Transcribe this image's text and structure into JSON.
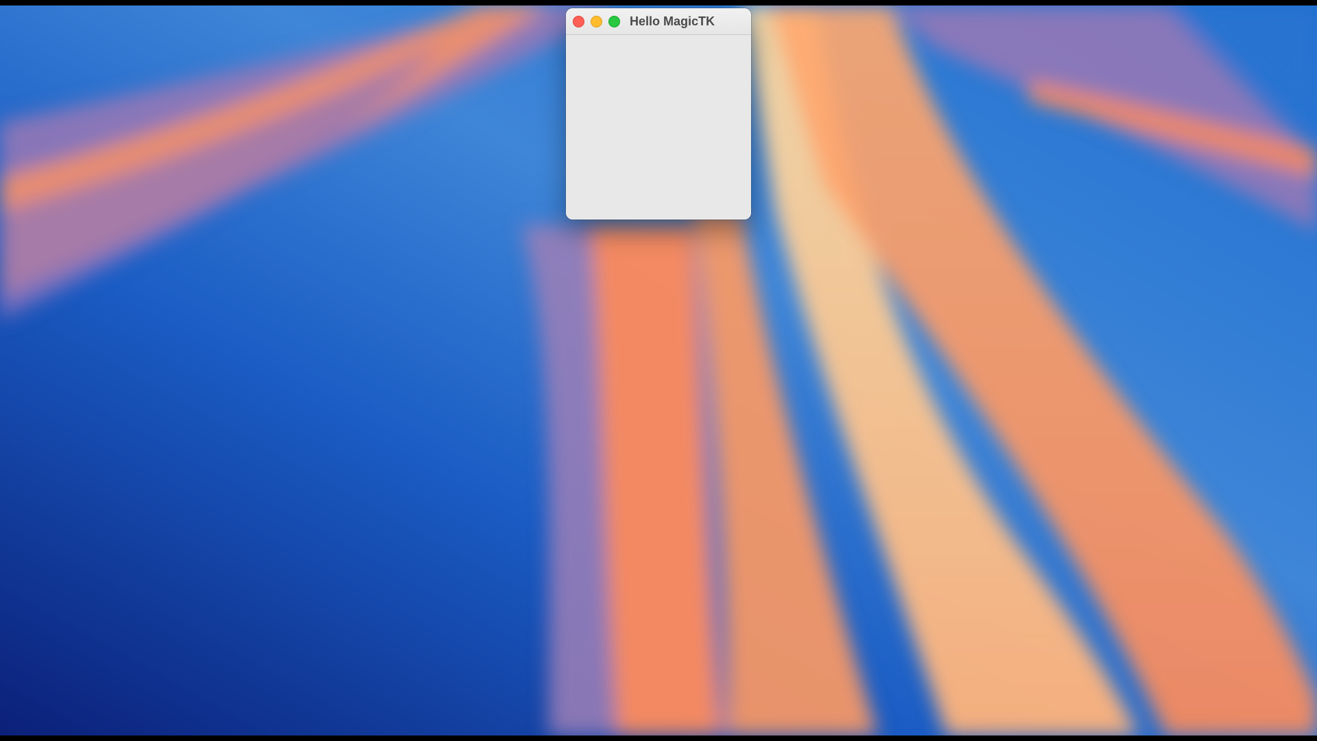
{
  "window": {
    "title": "Hello MagicTK",
    "controls": {
      "close": "close-icon",
      "minimize": "minimize-icon",
      "zoom": "zoom-icon"
    },
    "colors": {
      "close": "#ff5f57",
      "minimize": "#febc2e",
      "zoom": "#28c840",
      "content_background": "#e8e8e8"
    }
  },
  "desktop": {
    "wallpaper_colors": [
      "#0b2a86",
      "#1f6fd0",
      "#8e6fb3",
      "#ff8a55",
      "#f7d3a0"
    ]
  }
}
